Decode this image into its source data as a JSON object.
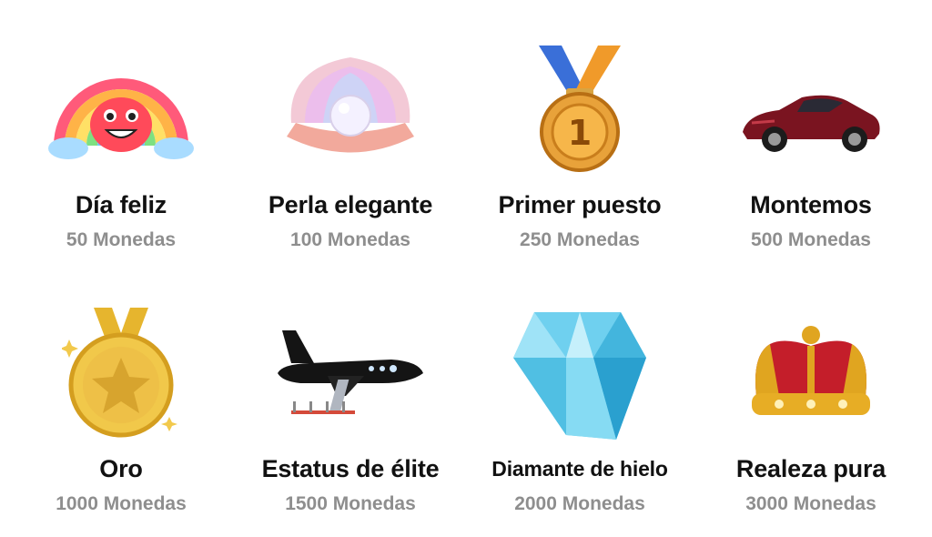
{
  "gifts": [
    {
      "name": "Día feliz",
      "price": "50 Monedas",
      "icon": "rainbow-icon"
    },
    {
      "name": "Perla elegante",
      "price": "100 Monedas",
      "icon": "pearl-shell-icon"
    },
    {
      "name": "Primer puesto",
      "price": "250 Monedas",
      "icon": "first-place-medal-icon"
    },
    {
      "name": "Montemos",
      "price": "500 Monedas",
      "icon": "sports-car-icon"
    },
    {
      "name": "Oro",
      "price": "1000 Monedas",
      "icon": "gold-star-medal-icon"
    },
    {
      "name": "Estatus de élite",
      "price": "1500 Monedas",
      "icon": "private-jet-icon"
    },
    {
      "name": "Diamante de hielo",
      "price": "2000 Monedas",
      "icon": "diamond-icon"
    },
    {
      "name": "Realeza pura",
      "price": "3000 Monedas",
      "icon": "crown-icon"
    }
  ],
  "medal_number": "1"
}
